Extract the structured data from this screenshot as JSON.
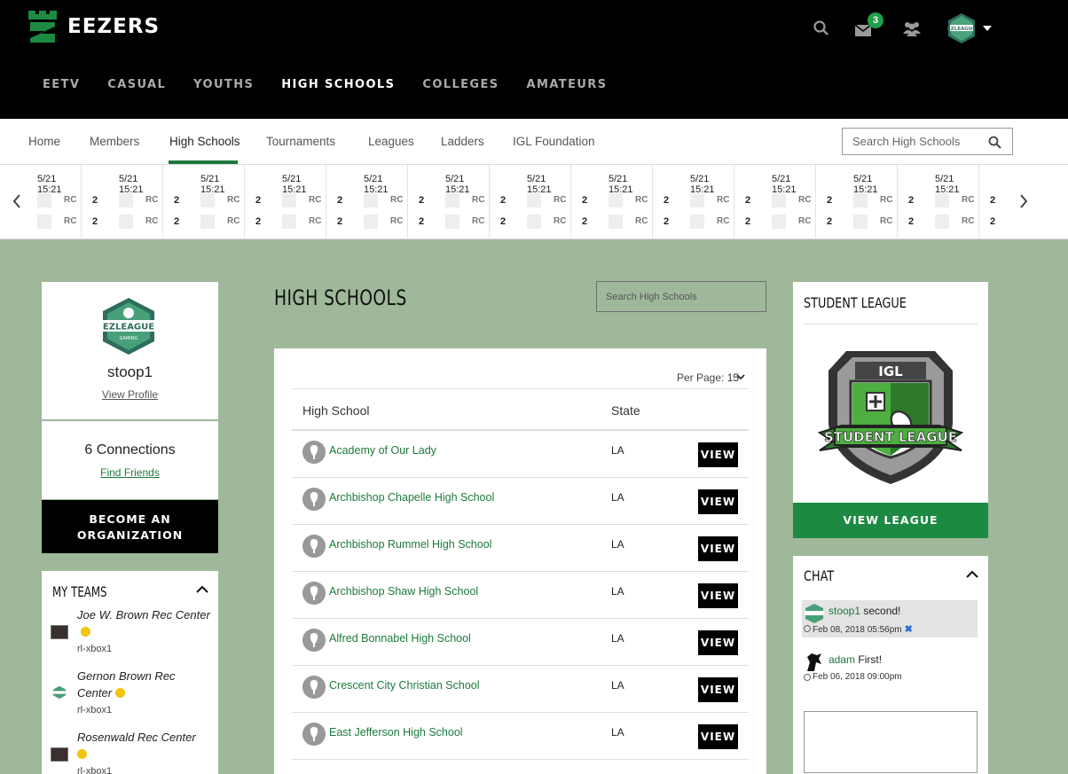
{
  "brand": {
    "name": "EEZERS",
    "color": "#1c8a43"
  },
  "top_icons": {
    "notification_count": "3"
  },
  "main_nav": [
    "EETV",
    "CASUAL",
    "YOUTHS",
    "HIGH SCHOOLS",
    "COLLEGES",
    "AMATEURS"
  ],
  "main_nav_active": "HIGH SCHOOLS",
  "sub_nav": {
    "items": [
      "Home",
      "Members",
      "High Schools",
      "Tournaments",
      "Leagues",
      "Ladders",
      "IGL Foundation"
    ],
    "active": "High Schools",
    "search_placeholder": "Search High Schools"
  },
  "ticker": [
    {
      "date": "5/21 15:21",
      "t1": "RC",
      "s1": "2",
      "t2": "RC",
      "s2": "2"
    },
    {
      "date": "5/21 15:21",
      "t1": "RC",
      "s1": "2",
      "t2": "RC",
      "s2": "2"
    },
    {
      "date": "5/21 15:21",
      "t1": "RC",
      "s1": "2",
      "t2": "RC",
      "s2": "2"
    },
    {
      "date": "5/21 15:21",
      "t1": "RC",
      "s1": "2",
      "t2": "RC",
      "s2": "2"
    },
    {
      "date": "5/21 15:21",
      "t1": "RC",
      "s1": "2",
      "t2": "RC",
      "s2": "2"
    },
    {
      "date": "5/21 15:21",
      "t1": "RC",
      "s1": "2",
      "t2": "RC",
      "s2": "2"
    },
    {
      "date": "5/21 15:21",
      "t1": "RC",
      "s1": "2",
      "t2": "RC",
      "s2": "2"
    },
    {
      "date": "5/21 15:21",
      "t1": "RC",
      "s1": "2",
      "t2": "RC",
      "s2": "2"
    },
    {
      "date": "5/21 15:21",
      "t1": "RC",
      "s1": "2",
      "t2": "RC",
      "s2": "2"
    },
    {
      "date": "5/21 15:21",
      "t1": "RC",
      "s1": "2",
      "t2": "RC",
      "s2": "2"
    },
    {
      "date": "5/21 15:21",
      "t1": "RC",
      "s1": "2",
      "t2": "RC",
      "s2": "2"
    },
    {
      "date": "5/21 15:21",
      "t1": "RC",
      "s1": "2",
      "t2": "RC",
      "s2": "2"
    }
  ],
  "profile": {
    "avatar_text": "EZLEAGUE",
    "avatar_sub": "GAMING",
    "username": "stoop1",
    "view_profile": "View Profile"
  },
  "connections": {
    "count_label": "6 Connections",
    "find_friends": "Find Friends"
  },
  "organization_button": [
    "BECOME AN",
    "ORGANIZATION"
  ],
  "my_teams": {
    "title": "MY TEAMS",
    "teams": [
      {
        "name": "Joe W. Brown Rec Center",
        "platform": "rl-xbox1"
      },
      {
        "name": "Gernon Brown Rec Center",
        "platform": "rl-xbox1"
      },
      {
        "name": "Rosenwald Rec Center",
        "platform": "rl-xbox1"
      }
    ]
  },
  "high_schools": {
    "title": "HIGH SCHOOLS",
    "search_placeholder": "Search High Schools",
    "per_page_label": "Per Page:",
    "per_page_value": "15",
    "columns": [
      "High School",
      "State"
    ],
    "view_label": "VIEW",
    "rows": [
      {
        "name": "Academy of Our Lady",
        "state": "LA"
      },
      {
        "name": "Archbishop Chapelle High School",
        "state": "LA"
      },
      {
        "name": "Archbishop Rummel High School",
        "state": "LA"
      },
      {
        "name": "Archbishop Shaw High School",
        "state": "LA"
      },
      {
        "name": "Alfred Bonnabel High School",
        "state": "LA"
      },
      {
        "name": "Crescent City Christian School",
        "state": "LA"
      },
      {
        "name": "East Jefferson High School",
        "state": "LA"
      }
    ]
  },
  "student_league": {
    "title": "STUDENT LEAGUE",
    "badge_top": "IGL",
    "badge_banner": "STUDENT LEAGUE",
    "button": "VIEW LEAGUE"
  },
  "chat": {
    "title": "CHAT",
    "messages": [
      {
        "user": "stoop1",
        "text": " second!",
        "time": "Feb 08, 2018 05:56pm"
      },
      {
        "user": "adam",
        "text": " First!",
        "time": "Feb 06, 2018 09:00pm"
      }
    ]
  }
}
